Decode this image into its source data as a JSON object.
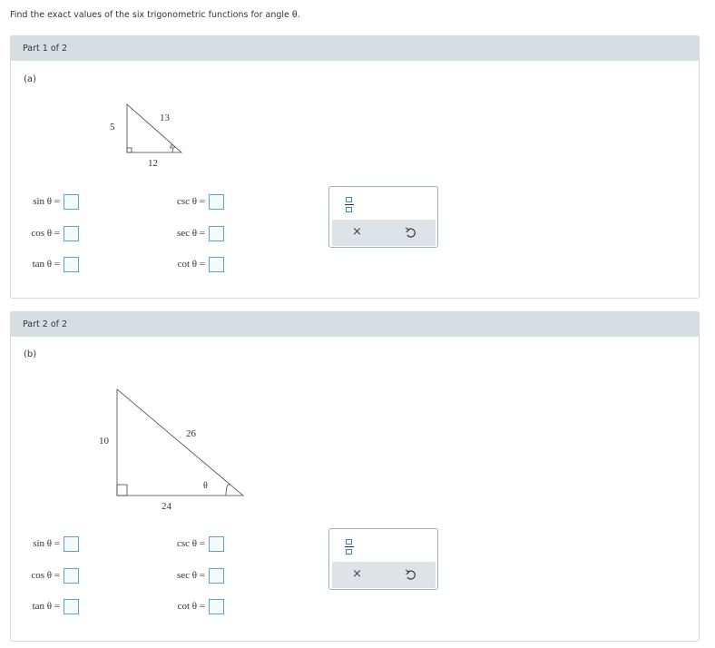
{
  "instruction": "Find the exact values of the six trigonometric functions for angle θ.",
  "parts": [
    {
      "header": "Part 1 of 2",
      "letter": "(a)",
      "triangle": {
        "vertical": "5",
        "hypotenuse": "13",
        "horizontal": "12",
        "angle": "θ"
      },
      "functions": {
        "sin": "sin θ =",
        "cos": "cos θ =",
        "tan": "tan θ =",
        "csc": "csc θ =",
        "sec": "sec θ =",
        "cot": "cot θ ="
      }
    },
    {
      "header": "Part 2 of 2",
      "letter": "(b)",
      "triangle": {
        "vertical": "10",
        "hypotenuse": "26",
        "horizontal": "24",
        "angle": "θ"
      },
      "functions": {
        "sin": "sin θ =",
        "cos": "cos θ =",
        "tan": "tan θ =",
        "csc": "csc θ =",
        "sec": "sec θ =",
        "cot": "cot θ ="
      }
    }
  ],
  "toolbar": {
    "clear_symbol": "×",
    "icons": [
      "fraction-icon",
      "close-icon",
      "undo-icon"
    ]
  },
  "colors": {
    "header_bg": "#d7dee1",
    "answer_border": "#5aa5cc",
    "toolbar_border": "#9bb1c3",
    "action_bg": "#dde3e6"
  }
}
